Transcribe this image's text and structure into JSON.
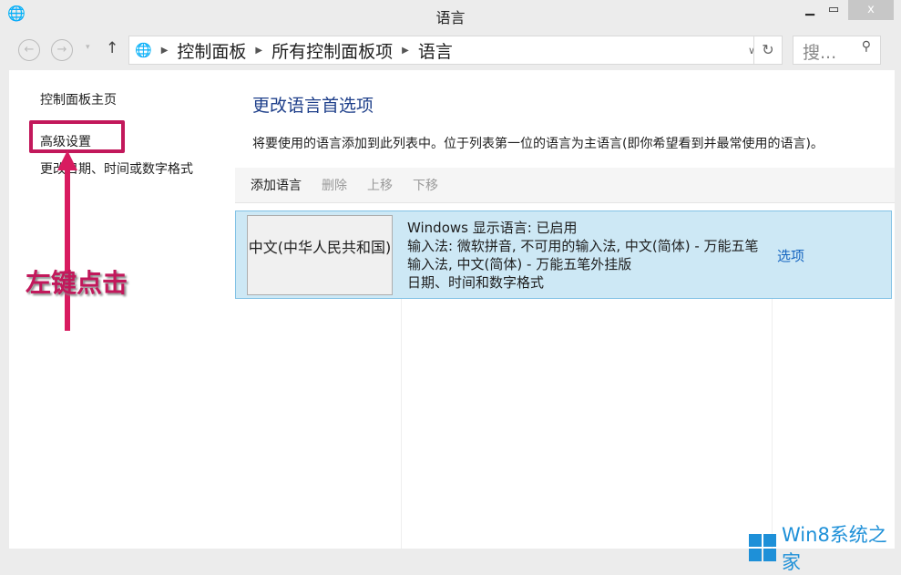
{
  "window": {
    "title": "语言",
    "close": "x"
  },
  "address": {
    "crumbs": [
      "控制面板",
      "所有控制面板项",
      "语言"
    ],
    "search_placeholder": "搜..."
  },
  "sidebar": {
    "items": [
      "控制面板主页",
      "高级设置",
      "更改日期、时间或数字格式"
    ]
  },
  "annotation": "左键点击",
  "main": {
    "heading": "更改语言首选项",
    "description": "将要使用的语言添加到此列表中。位于列表第一位的语言为主语言(即你希望看到并最常使用的语言)。",
    "toolbar": {
      "add": "添加语言",
      "remove": "删除",
      "up": "上移",
      "down": "下移"
    },
    "languages": [
      {
        "name": "中文(中华人民共和国)",
        "display": "Windows 显示语言: 已启用",
        "ime": "输入法: 微软拼音, 不可用的输入法, 中文(简体) - 万能五笔输入法, 中文(简体) - 万能五笔外挂版",
        "format": "日期、时间和数字格式",
        "options": "选项"
      }
    ]
  },
  "watermark": "Win8系统之家"
}
